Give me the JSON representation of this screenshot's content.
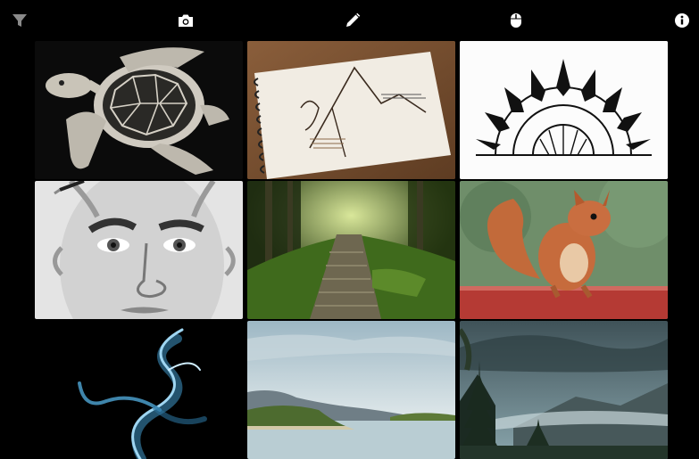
{
  "toolbar": {
    "buttons": [
      {
        "name": "filter-icon",
        "color": "#8a8a8a"
      },
      {
        "name": "camera-icon",
        "color": "#ffffff"
      },
      {
        "name": "pencil-icon",
        "color": "#ffffff"
      },
      {
        "name": "mouse-icon",
        "color": "#ffffff"
      },
      {
        "name": "info-icon",
        "color": "#ffffff"
      }
    ]
  },
  "gallery": {
    "items": [
      {
        "subject": "sea-turtle-drawing"
      },
      {
        "subject": "sketchbook-drawing"
      },
      {
        "subject": "mandala-drawing"
      },
      {
        "subject": "face-pencil-drawing"
      },
      {
        "subject": "forest-path-photo"
      },
      {
        "subject": "red-squirrel-photo"
      },
      {
        "subject": "blue-smoke-photo"
      },
      {
        "subject": "lake-island-photo"
      },
      {
        "subject": "misty-mountains-photo"
      }
    ]
  }
}
